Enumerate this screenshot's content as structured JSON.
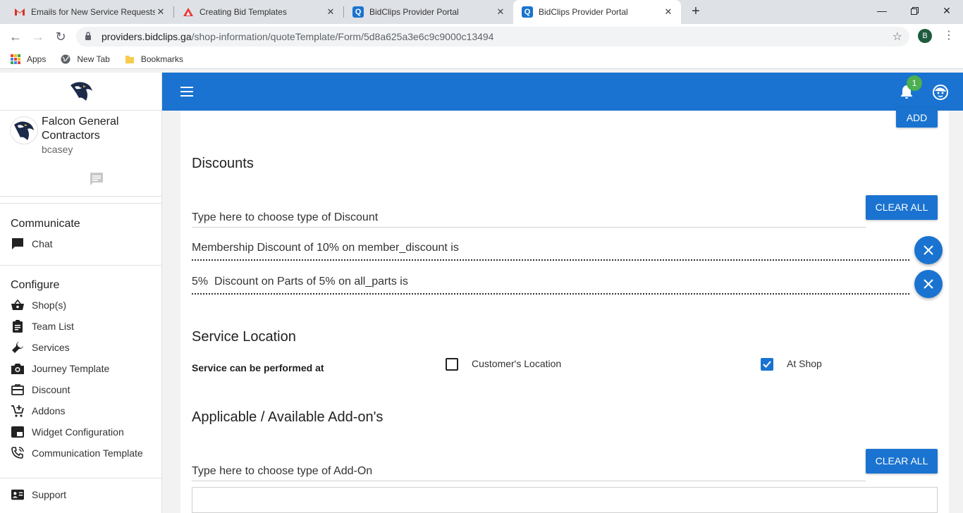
{
  "browser": {
    "tabs": [
      {
        "title": "Emails for New Service Requests",
        "icon": "gmail-icon"
      },
      {
        "title": "Creating Bid Templates",
        "icon": "bid-templates-icon"
      },
      {
        "title": "BidClips Provider Portal",
        "icon": "bidclips-icon"
      },
      {
        "title": "BidClips Provider Portal",
        "icon": "bidclips-icon",
        "active": true
      }
    ],
    "url_host": "providers.bidclips.ga",
    "url_path": "/shop-information/quoteTemplate/Form/5d8a625a3e6c9c9000c13494",
    "profile_initial": "B",
    "bookmarks": [
      "Apps",
      "New Tab",
      "Bookmarks"
    ]
  },
  "sidebar": {
    "company": "Falcon General Contractors",
    "company_line1": "Falcon General",
    "company_line2": "Contractors",
    "username": "bcasey",
    "communicate": {
      "title": "Communicate",
      "items": [
        {
          "label": "Chat",
          "icon": "chat-icon"
        }
      ]
    },
    "configure": {
      "title": "Configure",
      "items": [
        {
          "label": "Shop(s)",
          "icon": "basket-icon"
        },
        {
          "label": "Team List",
          "icon": "clipboard-icon"
        },
        {
          "label": "Services",
          "icon": "wrench-icon"
        },
        {
          "label": "Journey Template",
          "icon": "camera-icon"
        },
        {
          "label": "Discount",
          "icon": "gift-card-icon"
        },
        {
          "label": "Addons",
          "icon": "cart-add-icon"
        },
        {
          "label": "Widget Configuration",
          "icon": "widget-icon"
        },
        {
          "label": "Communication Template",
          "icon": "phone-icon"
        }
      ]
    },
    "support": {
      "label": "Support",
      "icon": "contact-card-icon"
    }
  },
  "appbar": {
    "notification_count": "1"
  },
  "main": {
    "add_label": "ADD",
    "discounts": {
      "title": "Discounts",
      "placeholder": "Type here to choose type of Discount",
      "clear_label": "CLEAR ALL",
      "items": [
        "Membership Discount of 10% on member_discount is",
        "5%  Discount on Parts of 5% on all_parts is"
      ]
    },
    "service_location": {
      "title": "Service Location",
      "label": "Service can be performed at",
      "options": [
        {
          "label": "Customer's Location",
          "checked": false
        },
        {
          "label": "At Shop",
          "checked": true
        }
      ]
    },
    "addons": {
      "title": "Applicable / Available Add-on's",
      "placeholder": "Type here to choose type of Add-On",
      "clear_label": "CLEAR ALL"
    }
  },
  "colors": {
    "primary": "#1a73d0",
    "badge": "#4caf50"
  }
}
